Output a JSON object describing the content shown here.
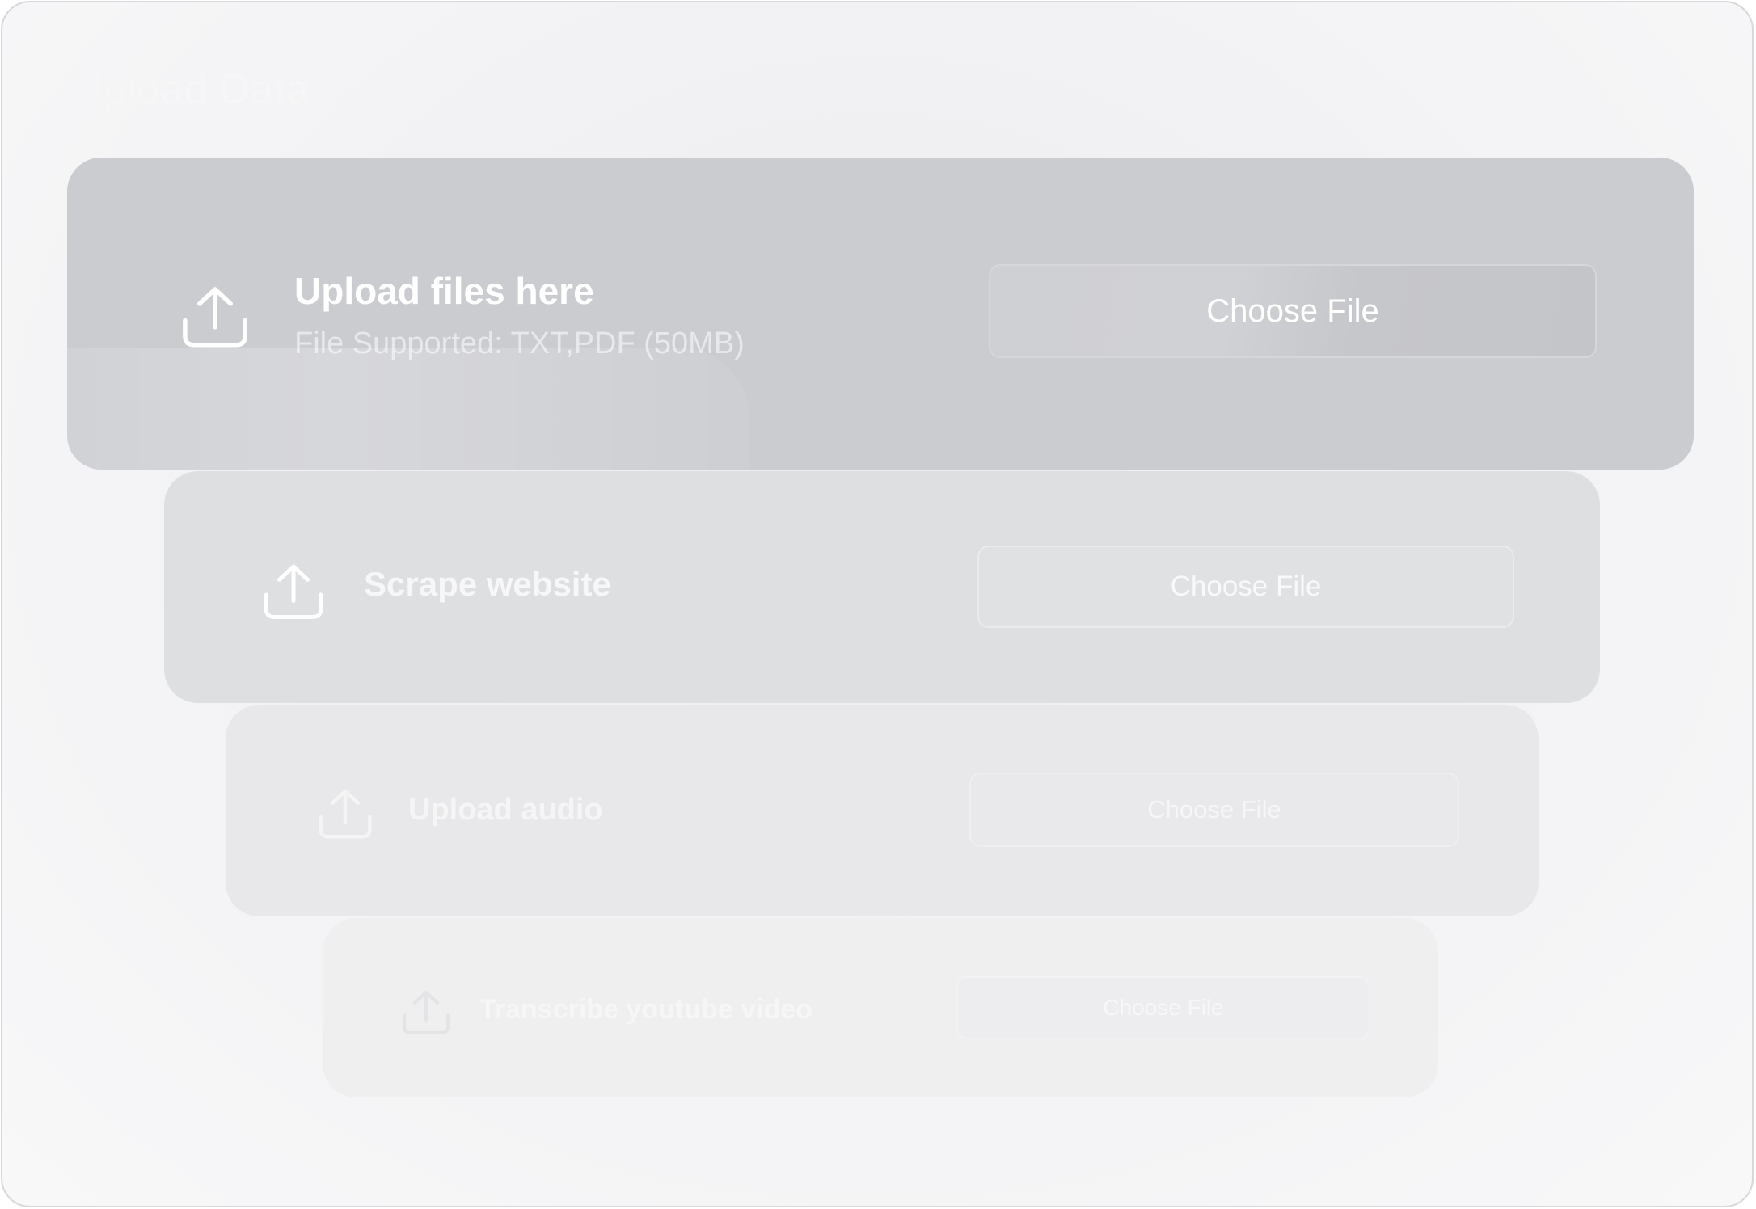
{
  "page": {
    "title": "Upload Data"
  },
  "cards": [
    {
      "title": "Upload files here",
      "subtitle": "File Supported: TXT,PDF  (50MB)",
      "button_label": "Choose File",
      "icon": "upload-icon"
    },
    {
      "title": "Scrape website",
      "button_label": "Choose File",
      "icon": "upload-icon"
    },
    {
      "title": "Upload audio",
      "button_label": "Choose File",
      "icon": "upload-icon"
    },
    {
      "title": "Transcribe youtube video",
      "button_label": "Choose File",
      "icon": "upload-icon"
    }
  ],
  "colors": {
    "background": "#f3f3f5",
    "card_active": "#cbccd0",
    "text": "#ffffff"
  }
}
